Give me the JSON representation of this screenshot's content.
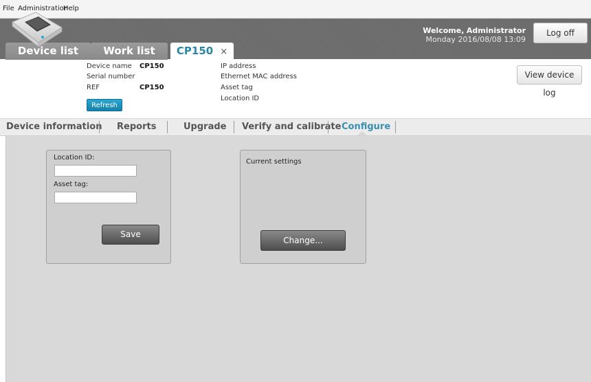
{
  "menu": [
    "File",
    "Administration",
    "Help"
  ],
  "header": {
    "welcome_label": "Welcome,",
    "user": "Administrator",
    "day": "Monday",
    "datetime": "2016/08/08 13:09",
    "logoff": "Log off"
  },
  "tabs": [
    {
      "label": "Device list"
    },
    {
      "label": "Work list"
    },
    {
      "label": "CP150",
      "close": "×"
    }
  ],
  "device": {
    "name_label": "Device name",
    "name_value": "CP150",
    "serial_label": "Serial number",
    "serial_value": "",
    "ref_label": "REF",
    "ref_value": "CP150",
    "ip_label": "IP address",
    "mac_label": "Ethernet MAC address",
    "asset_label": "Asset tag",
    "location_label": "Location ID",
    "refresh": "Refresh",
    "view_log": "View device log"
  },
  "subnav": [
    "Device information",
    "Reports",
    "Upgrade",
    "Verify and calibrate",
    "Configure"
  ],
  "configure": {
    "location_label": "Location ID:",
    "location_value": "",
    "asset_label": "Asset tag:",
    "asset_value": "",
    "save": "Save",
    "current_settings": "Current settings",
    "change": "Change..."
  },
  "colors": {
    "accent": "#2a87a8",
    "header_bg": "#6c6c6c",
    "content_bg": "#d9d9d9"
  }
}
